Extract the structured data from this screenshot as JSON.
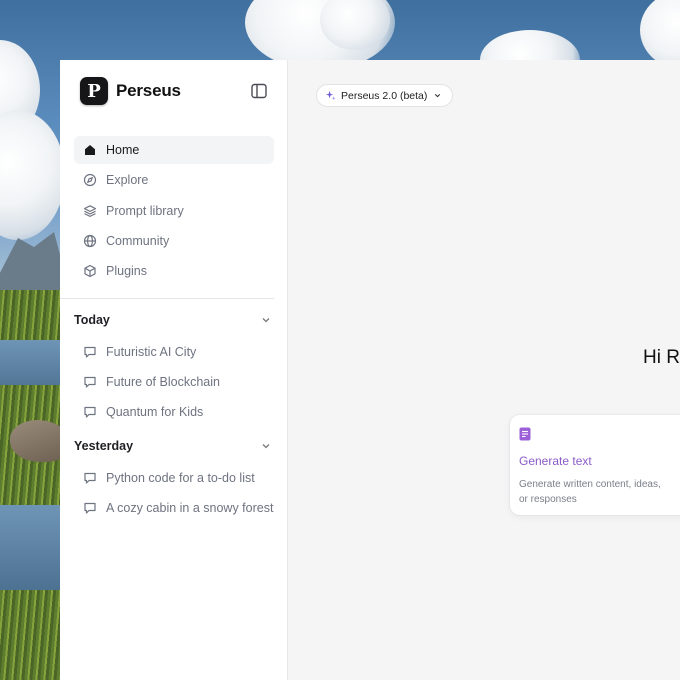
{
  "app": {
    "name": "Perseus",
    "logo_letter": "P"
  },
  "sidebar": {
    "nav_items": [
      {
        "label": "Home",
        "icon": "home-icon",
        "active": true
      },
      {
        "label": "Explore",
        "icon": "compass-icon",
        "active": false
      },
      {
        "label": "Prompt library",
        "icon": "layers-icon",
        "active": false
      },
      {
        "label": "Community",
        "icon": "globe-icon",
        "active": false
      },
      {
        "label": "Plugins",
        "icon": "cube-icon",
        "active": false
      }
    ],
    "sections": [
      {
        "title": "Today",
        "items": [
          "Futuristic AI City",
          "Future of Blockchain",
          "Quantum for Kids"
        ]
      },
      {
        "title": "Yesterday",
        "items": [
          "Python code for a to-do list",
          "A cozy cabin in a snowy forest"
        ]
      }
    ]
  },
  "main": {
    "model_selector": "Perseus 2.0 (beta)",
    "greeting": "Hi Ro",
    "cards": [
      {
        "title": "Generate text",
        "description": "Generate written content, ideas, or responses",
        "icon": "document-icon"
      }
    ]
  },
  "colors": {
    "accent": "#8b5cc8",
    "text_primary": "#1a1a1c",
    "text_muted": "#6e7380"
  }
}
